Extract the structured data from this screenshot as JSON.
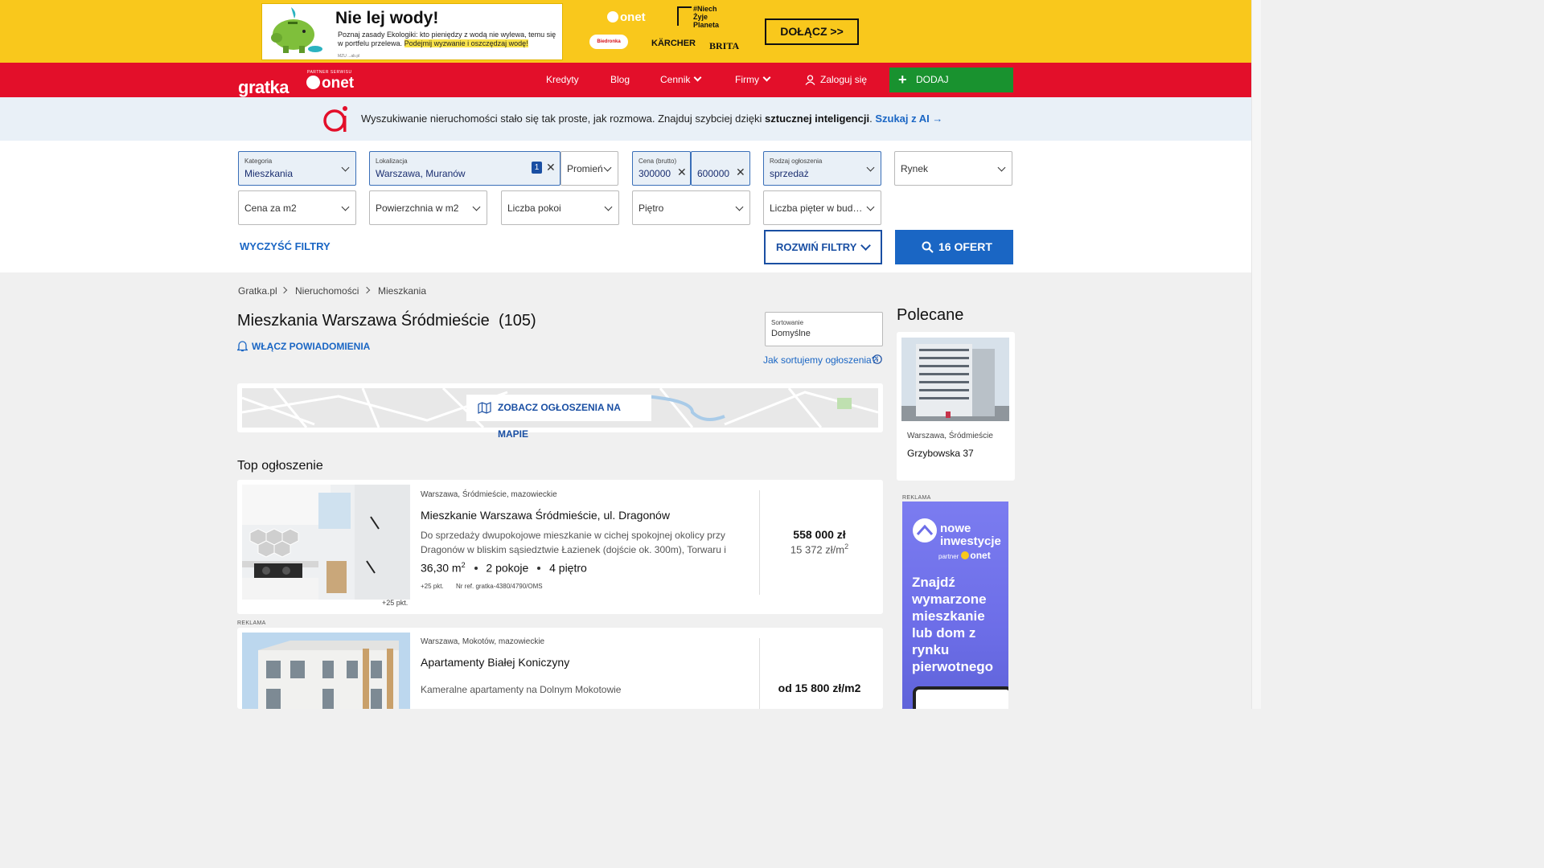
{
  "top_ad": {
    "title": "Nie lej wody!",
    "text_plain": "Poznaj zasady Ekologiki: kto pieniędzy z wodą nie wylewa, temu się w portfelu przelewa.",
    "text_highlight": "Podejmij wyzwanie i oszczędzaj wodę!",
    "footnote": "MZU   ...ab.pl",
    "logo_onet": "onet",
    "logo_niech": "#Niech Żyje Planeta",
    "logo_biedronka": "Biedronka",
    "logo_karcher": "KÄRCHER",
    "logo_brita": "BRITA",
    "cta": "DOŁĄCZ >>",
    "colors": {
      "background": "#f9c81c"
    }
  },
  "nav": {
    "logo": "gratka",
    "partner_note": "PARTNER SERWISU",
    "partner_logo": "onet",
    "links": {
      "kredyty": "Kredyty",
      "blog": "Blog",
      "cennik": "Cennik",
      "firmy": "Firmy"
    },
    "login": "Zaloguj się",
    "add_listing": "DODAJ OGŁOSZENIE",
    "colors": {
      "background": "#e30f2a",
      "add_button": "#19922f"
    }
  },
  "ai_banner": {
    "text": "Wyszukiwanie nieruchomości stało się tak proste, jak rozmowa. Znajduj szybciej dzięki",
    "bold": "sztucznej inteligencji",
    "link": "Szukaj z AI"
  },
  "filters": {
    "category": {
      "label": "Kategoria",
      "value": "Mieszkania"
    },
    "location": {
      "label": "Lokalizacja",
      "value": "Warszawa, Muranów",
      "count": "1"
    },
    "radius": {
      "placeholder": "Promień"
    },
    "price": {
      "label": "Cena (brutto)",
      "from": "300000",
      "to": "600000"
    },
    "offer_type": {
      "label": "Rodzaj ogłoszenia",
      "value": "sprzedaż"
    },
    "market": {
      "placeholder": "Rynek"
    },
    "price_m2": {
      "placeholder": "Cena za m2"
    },
    "area": {
      "placeholder": "Powierzchnia w m2"
    },
    "rooms": {
      "placeholder": "Liczba pokoi"
    },
    "floor": {
      "placeholder": "Piętro"
    },
    "building_floors": {
      "placeholder": "Liczba pięter w budynku"
    },
    "clear": "WYCZYŚĆ FILTRY",
    "expand": "ROZWIŃ FILTRY",
    "search": "16 OFERT"
  },
  "breadcrumb": [
    "Gratka.pl",
    "Nieruchomości",
    "Mieszkania"
  ],
  "heading": {
    "title": "Mieszkania Warszawa Śródmieście",
    "count": "(105)",
    "notify": "WŁĄCZ POWIADOMIENIA"
  },
  "sort": {
    "label": "Sortowanie",
    "value": "Domyślne",
    "help": "Jak sortujemy ogłoszenia?"
  },
  "map_button": "ZOBACZ OGŁOSZENIA NA MAPIE",
  "top_label": "Top ogłoszenie",
  "listings": [
    {
      "location": "Warszawa, Śródmieście, mazowieckie",
      "title": "Mieszkanie Warszawa Śródmieście, ul. Dragonów",
      "description": "Do sprzedaży dwupokojowe mieszkanie w cichej spokojnej okolicy przy Dragonów w bliskim sąsiedztwie Łazienek (dojście ok. 300m), Torwaru i Legii....",
      "area": "36,30 m",
      "area_sup": "2",
      "rooms": "2 pokoje",
      "floor": "4 piętro",
      "points": "+25 pkt.",
      "ref": "Nr ref. gratka-4380/4790/OMS",
      "photo_points": "+25 pkt.",
      "price": "558 000 zł",
      "price_m2": "15 372 zł/m",
      "price_m2_sup": "2"
    },
    {
      "ad_label": "REKLAMA",
      "location": "Warszawa, Mokotów, mazowieckie",
      "title": "Apartamenty Białej Koniczyny",
      "description": "Kameralne apartamenty na Dolnym Mokotowie",
      "price": "od 15 800 zł/m2"
    }
  ],
  "sidebar": {
    "title": "Polecane",
    "recommended": {
      "location": "Warszawa, Śródmieście",
      "name": "Grzybowska 37"
    },
    "ad_label": "REKLAMA",
    "ad": {
      "brand": "nowe inwestycje",
      "partner": "partner",
      "partner_logo": "onet",
      "claim": "Znajdź wymarzone mieszkanie lub dom z rynku pierwotnego"
    }
  }
}
